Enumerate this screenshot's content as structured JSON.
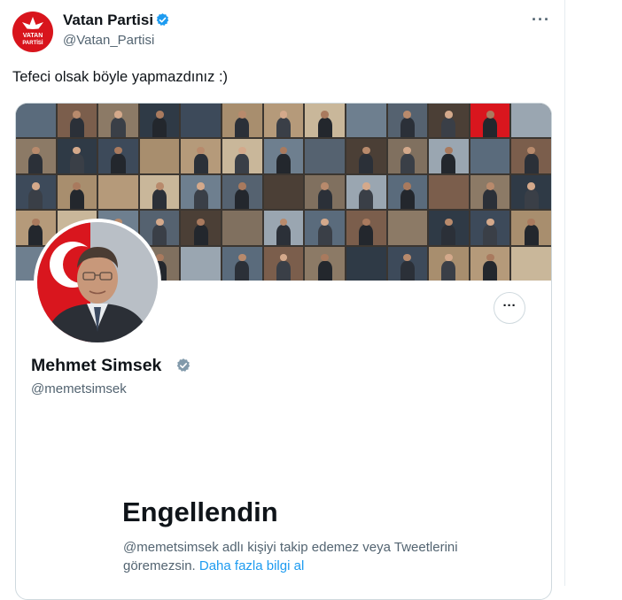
{
  "tweet": {
    "author_name": "Vatan Partisi",
    "author_handle": "@Vatan_Partisi",
    "logo_text_top": "VATAN",
    "logo_text_bottom": "PARTİSİ",
    "text": "Tefeci olsak böyle yapmazdınız :)",
    "more_label": "···"
  },
  "profile_card": {
    "name": "Mehmet Simsek",
    "handle": "@memetsimsek",
    "more_label": "···",
    "blocked_title": "Engellendin",
    "blocked_message": "@memetsimsek adlı kişiyi takip edemez veya Tweetlerini göremezsin.",
    "learn_more_link": "Daha fazla bilgi al"
  },
  "colors": {
    "brand_red": "#d8141c",
    "link_blue": "#1d9bf0",
    "verified_blue": "#1d9bf0",
    "verified_grey": "#829aab",
    "secondary_text": "#536471",
    "primary_text": "#0f1419"
  },
  "icons": {
    "verified_badge": "verified-badge-icon",
    "more": "more-horizontal-icon",
    "logo": "vatan-partisi-logo"
  }
}
